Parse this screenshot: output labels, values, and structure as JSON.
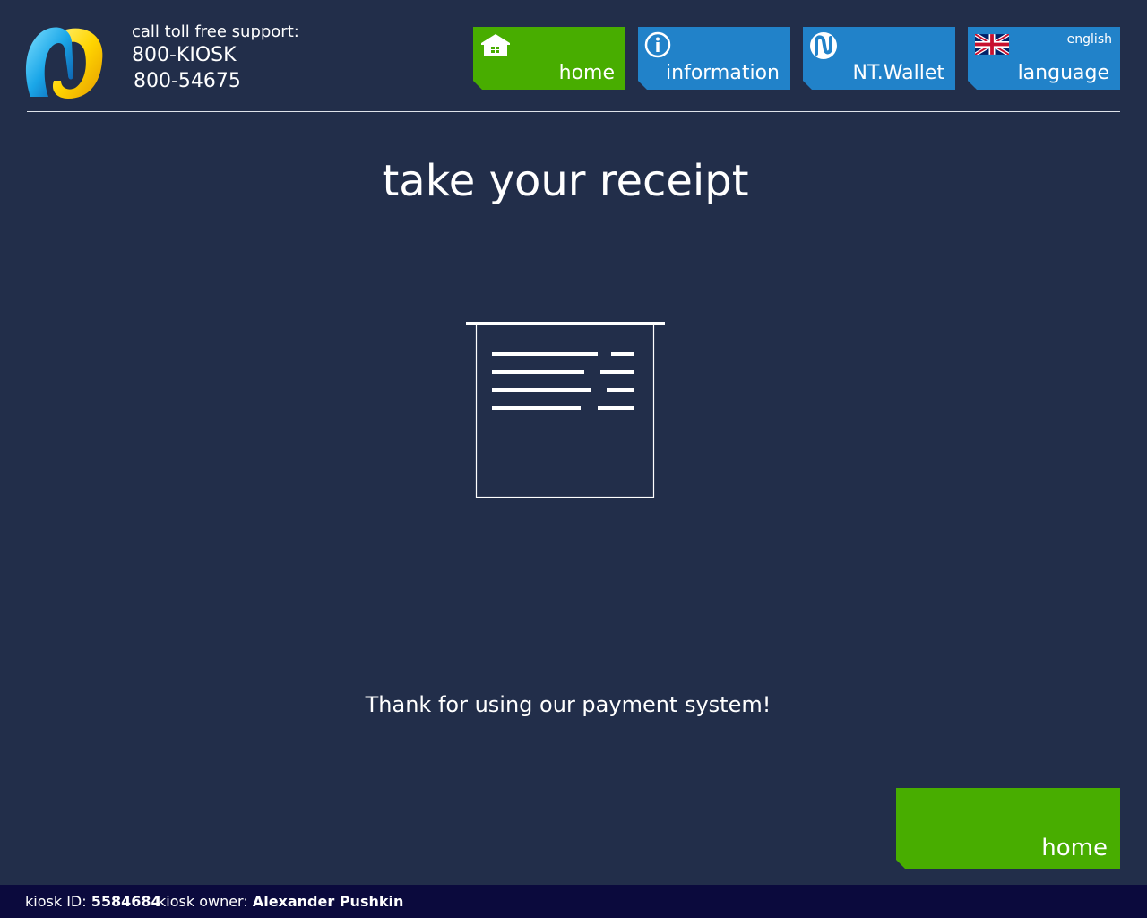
{
  "support": {
    "label": "call toll free support:",
    "phone1": "800-KIOSK",
    "phone2": "800-54675"
  },
  "nav": {
    "home": {
      "label": "home",
      "icon": "home-icon",
      "color": "#48ad00"
    },
    "information": {
      "label": "information",
      "icon": "info-icon",
      "color": "#2182c9"
    },
    "wallet": {
      "label": "NT.Wallet",
      "icon": "wallet-logo-icon",
      "color": "#2182c9"
    },
    "language": {
      "label": "language",
      "current": "english",
      "icon": "uk-flag-icon",
      "color": "#2182c9"
    }
  },
  "main": {
    "title": "take your receipt",
    "illustration": "receipt-icon",
    "thanks": "Thank for using our payment system!"
  },
  "bottom": {
    "home_label": "home"
  },
  "footer": {
    "kiosk_id_label": "kiosk ID:",
    "kiosk_id": "5584684",
    "owner_label": "kiosk owner:",
    "owner": "Alexander Pushkin"
  },
  "colors": {
    "background": "#222e4a",
    "accent_green": "#48ad00",
    "accent_blue": "#2182c9",
    "footer_bg": "#0b0a3d"
  }
}
